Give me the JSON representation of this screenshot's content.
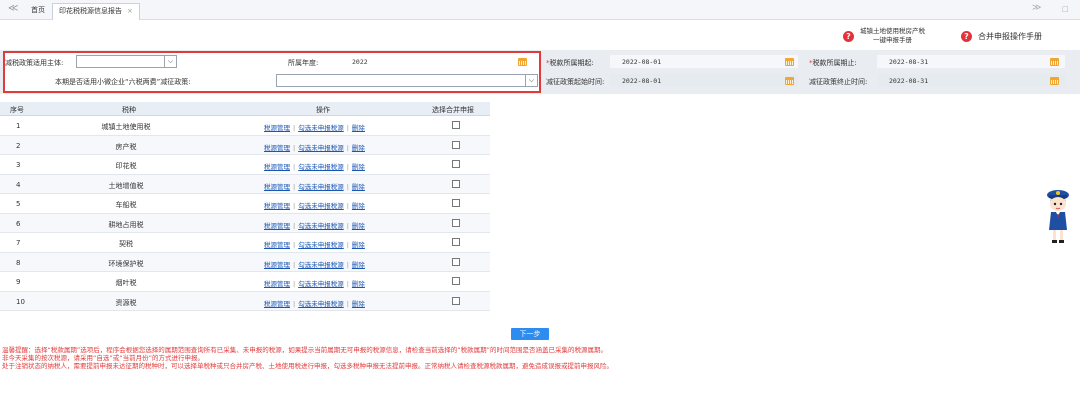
{
  "tabs": {
    "nav_left": "≪",
    "home": "首页",
    "active": "印花税税源信息报告",
    "close": "×",
    "nav_right": "≫",
    "window_btn": "□"
  },
  "help": {
    "link1_line1": "城镇土地使用税房产税",
    "link1_line2": "一键申报手册",
    "link2": "合并申报操作手册",
    "icon": "?"
  },
  "form": {
    "relief_subject_label": "减税政策适用主体:",
    "relief_subject_value": "",
    "year_label": "所属年度:",
    "year_value": "2022",
    "six_taxes_label": "本期是否适用小微企业“六税两费”减征政策:",
    "six_taxes_value": "",
    "period_start_label": "税款所属期起:",
    "period_start_value": "2022-08-01",
    "period_end_label": "税款所属期止:",
    "period_end_value": "2022-08-31",
    "relief_start_label": "减征政策起始时间:",
    "relief_start_value": "2022-08-01",
    "relief_end_label": "减征政策终止时间:",
    "relief_end_value": "2022-08-31",
    "required_mark": "*"
  },
  "table": {
    "headers": [
      "序号",
      "税种",
      "操作",
      "选择合并申报"
    ],
    "op_labels": [
      "税源管理",
      "勾选未申报税源",
      "删除"
    ],
    "op_sep": "|",
    "rows": [
      {
        "no": "1",
        "tax": "城镇土地使用税"
      },
      {
        "no": "2",
        "tax": "房产税"
      },
      {
        "no": "3",
        "tax": "印花税"
      },
      {
        "no": "4",
        "tax": "土地增值税"
      },
      {
        "no": "5",
        "tax": "车船税"
      },
      {
        "no": "6",
        "tax": "耕地占用税"
      },
      {
        "no": "7",
        "tax": "契税"
      },
      {
        "no": "8",
        "tax": "环境保护税"
      },
      {
        "no": "9",
        "tax": "烟叶税"
      },
      {
        "no": "10",
        "tax": "资源税"
      }
    ]
  },
  "next_button": "下一步",
  "notes": [
    "温馨提醒：选择“税款属期”选项后，程序会根据您选择的属期范围查询所有已采集、未申报的税源，如果提示当前属期无可申报的税源信息，请检查当前选择的“税款属期”的时间范围是否涵盖已采集的税源属期。",
    "非今天采集的按次税源，请采用“自选”或“当前月份”的方式进行申报。",
    "处于注销状态的纳税人，需要提前申报未达征期的税种时，可以选择单税种或只合并房产税、土地使用税进行申报，勾选多税种申报无法提前申报。正常纳税人请检查税源税款属期，避免造成误报或提前申报风险。"
  ],
  "colors": {
    "highlight_border": "#e03b3b",
    "link": "#1a56b4",
    "button": "#2d8cf0",
    "calendar_icon": "#f0a630"
  }
}
